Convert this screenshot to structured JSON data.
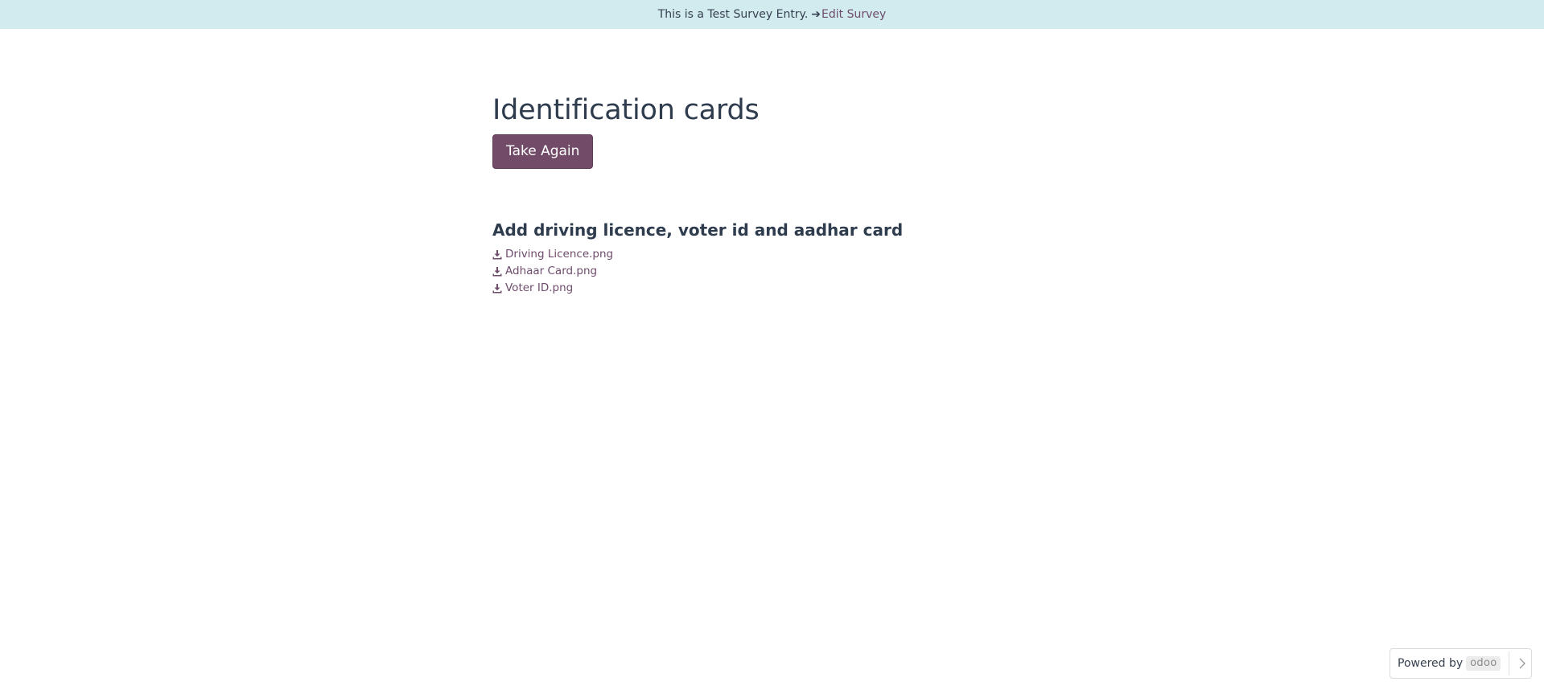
{
  "banner": {
    "text": "This is a Test Survey Entry.",
    "arrow": "➔",
    "link_label": "Edit Survey"
  },
  "survey": {
    "title": "Identification cards",
    "take_again_label": "Take Again"
  },
  "question": {
    "title": "Add driving licence, voter id and aadhar card",
    "files": [
      {
        "name": "Driving Licence.png",
        "icon": "download-icon"
      },
      {
        "name": "Adhaar Card.png",
        "icon": "download-icon"
      },
      {
        "name": "Voter ID.png",
        "icon": "download-icon"
      }
    ]
  },
  "footer": {
    "powered_label": "Powered by",
    "logo_text": "odoo",
    "chevron_icon": "chevron-right-icon"
  },
  "colors": {
    "banner_bg": "#d1ebef",
    "primary": "#714b67",
    "link": "#6f4c6c",
    "heading": "#2e3c4e"
  }
}
